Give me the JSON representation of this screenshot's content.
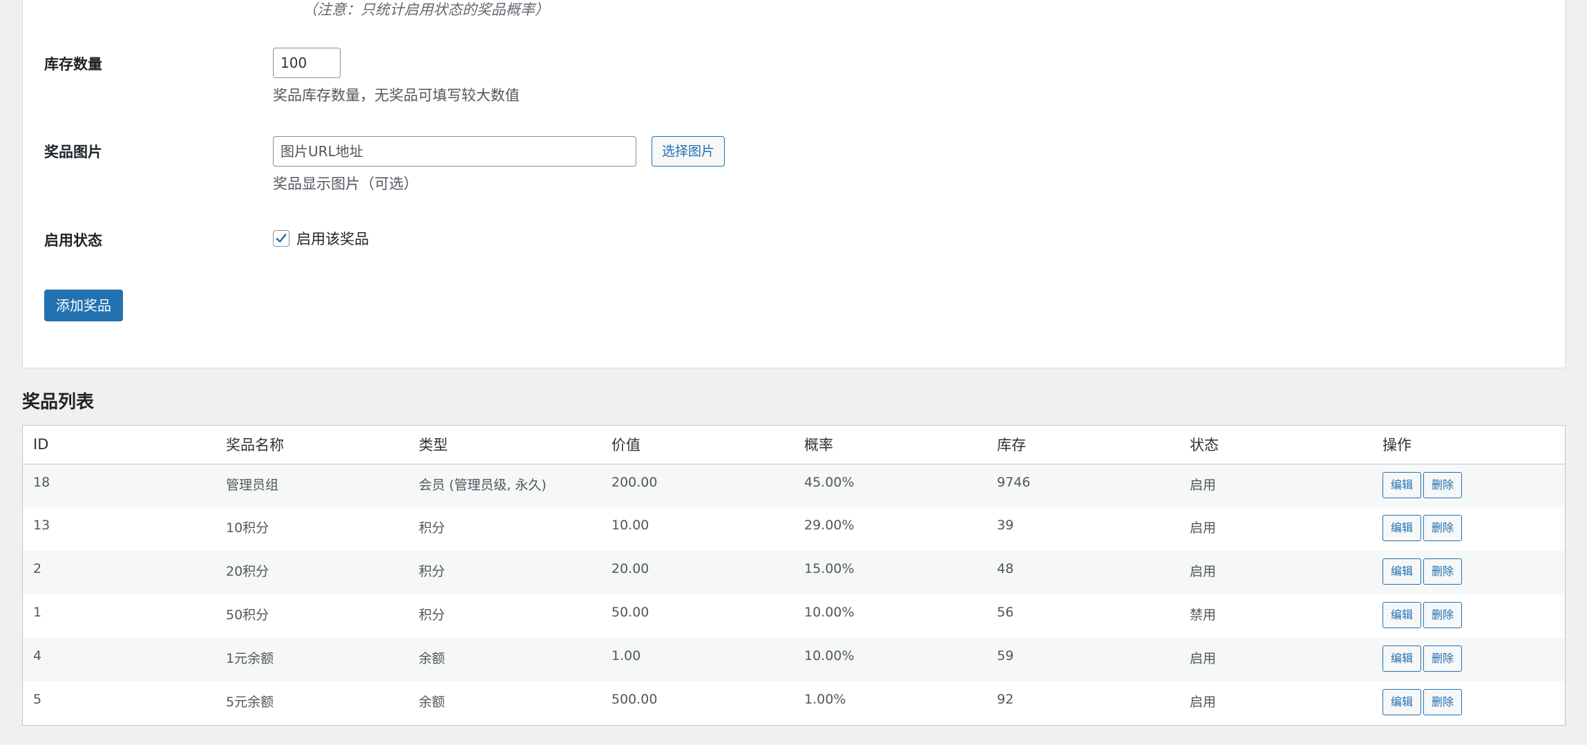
{
  "form": {
    "probability_note": "（注意：只统计启用状态的奖品概率）",
    "stock": {
      "label": "库存数量",
      "value": "100",
      "description": "奖品库存数量，无奖品可填写较大数值"
    },
    "image": {
      "label": "奖品图片",
      "placeholder": "图片URL地址",
      "value": "",
      "select_button": "选择图片",
      "description": "奖品显示图片（可选）"
    },
    "status": {
      "label": "启用状态",
      "checkbox_label": "启用该奖品",
      "checked": true
    },
    "submit_button": "添加奖品"
  },
  "prize_list": {
    "title": "奖品列表",
    "columns": [
      "ID",
      "奖品名称",
      "类型",
      "价值",
      "概率",
      "库存",
      "状态",
      "操作"
    ],
    "edit_label": "编辑",
    "delete_label": "删除",
    "rows": [
      {
        "id": "18",
        "name": "管理员组",
        "type": "会员 (管理员级, 永久)",
        "value": "200.00",
        "probability": "45.00%",
        "stock": "9746",
        "status": "启用"
      },
      {
        "id": "13",
        "name": "10积分",
        "type": "积分",
        "value": "10.00",
        "probability": "29.00%",
        "stock": "39",
        "status": "启用"
      },
      {
        "id": "2",
        "name": "20积分",
        "type": "积分",
        "value": "20.00",
        "probability": "15.00%",
        "stock": "48",
        "status": "启用"
      },
      {
        "id": "1",
        "name": "50积分",
        "type": "积分",
        "value": "50.00",
        "probability": "10.00%",
        "stock": "56",
        "status": "禁用"
      },
      {
        "id": "4",
        "name": "1元余额",
        "type": "余额",
        "value": "1.00",
        "probability": "10.00%",
        "stock": "59",
        "status": "启用"
      },
      {
        "id": "5",
        "name": "5元余额",
        "type": "余额",
        "value": "500.00",
        "probability": "1.00%",
        "stock": "92",
        "status": "启用"
      }
    ]
  },
  "colors": {
    "primary": "#2271b1",
    "background": "#f0f0f1",
    "card": "#ffffff"
  }
}
